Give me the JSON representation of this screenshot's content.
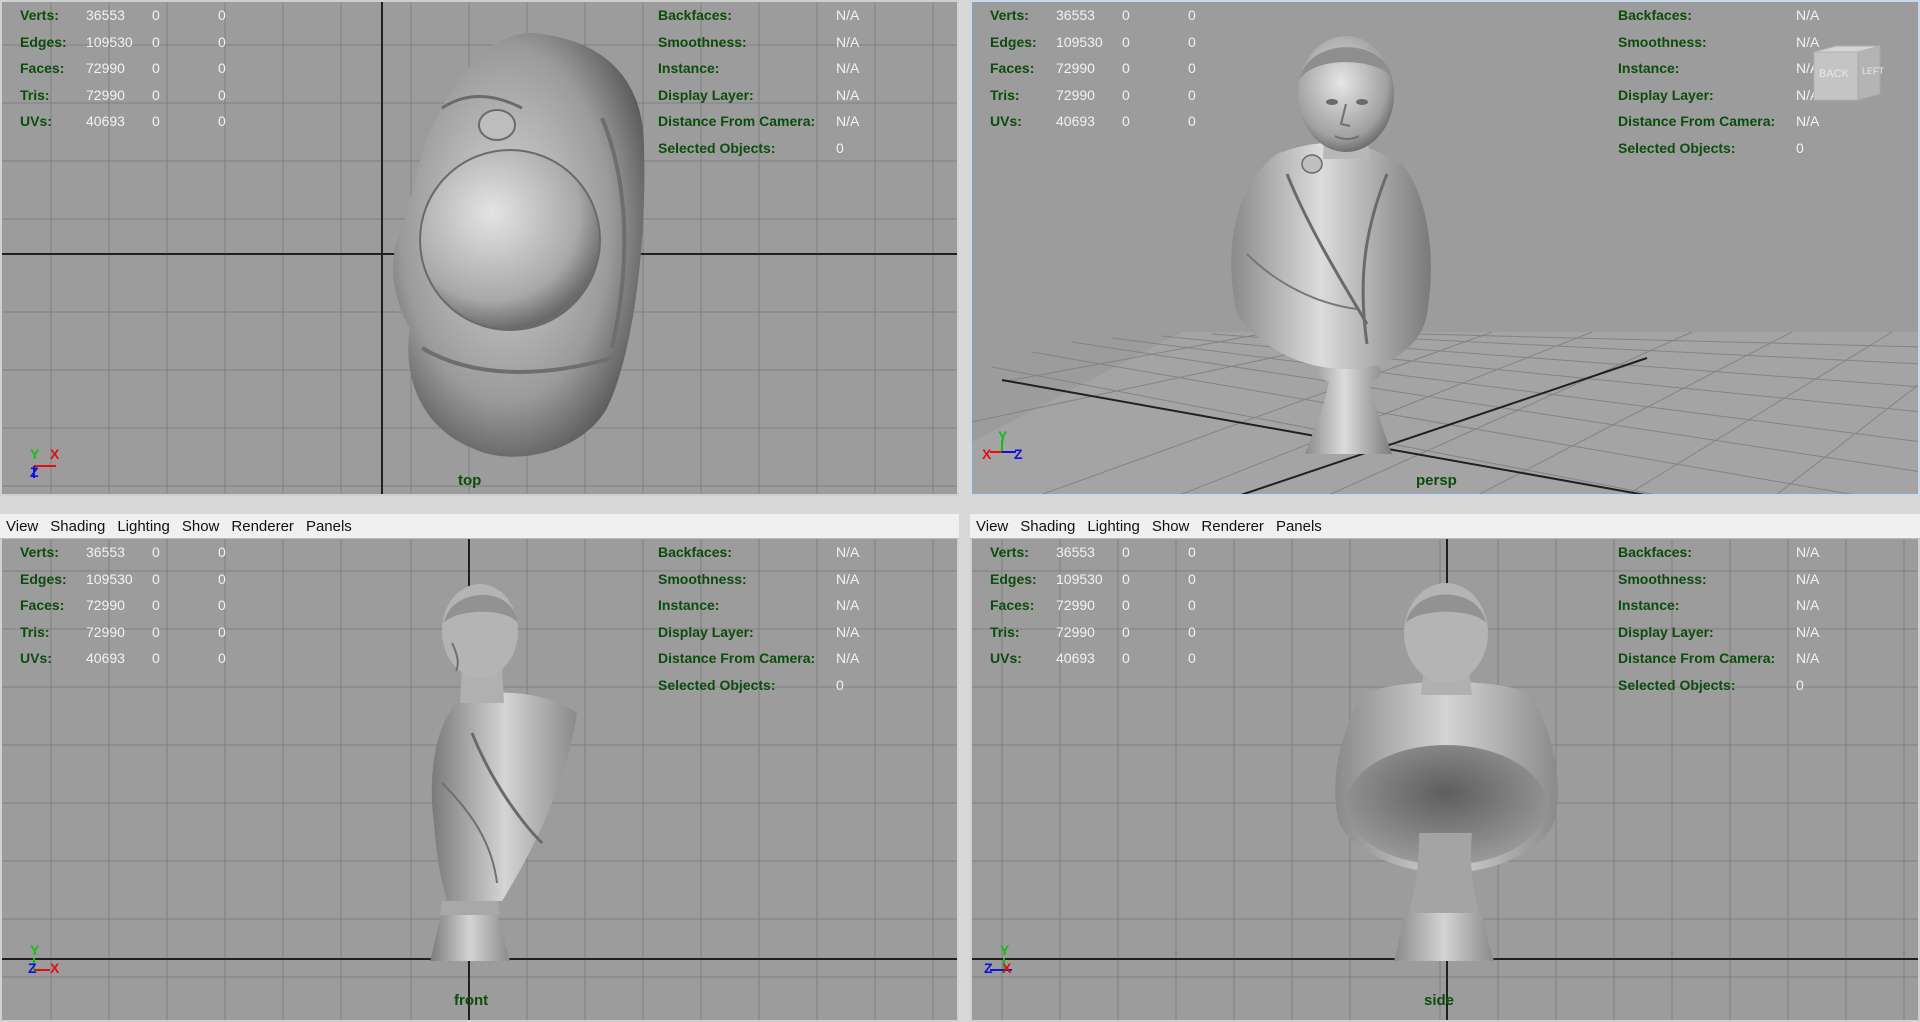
{
  "viewports": {
    "top": {
      "camera": "top",
      "hud_left": [
        {
          "label": "Verts:",
          "v1": "36553",
          "v2": "0",
          "v3": "0"
        },
        {
          "label": "Edges:",
          "v1": "109530",
          "v2": "0",
          "v3": "0"
        },
        {
          "label": "Faces:",
          "v1": "72990",
          "v2": "0",
          "v3": "0"
        },
        {
          "label": "Tris:",
          "v1": "72990",
          "v2": "0",
          "v3": "0"
        },
        {
          "label": "UVs:",
          "v1": "40693",
          "v2": "0",
          "v3": "0"
        }
      ],
      "hud_right": [
        {
          "label": "Backfaces:",
          "value": "N/A"
        },
        {
          "label": "Smoothness:",
          "value": "N/A"
        },
        {
          "label": "Instance:",
          "value": "N/A"
        },
        {
          "label": "Display Layer:",
          "value": "N/A"
        },
        {
          "label": "Distance From Camera:",
          "value": "N/A"
        },
        {
          "label": "Selected Objects:",
          "value": "0"
        }
      ],
      "axes": [
        "Y",
        "X",
        "Z"
      ]
    },
    "persp": {
      "camera": "persp",
      "hud_left": [
        {
          "label": "Verts:",
          "v1": "36553",
          "v2": "0",
          "v3": "0"
        },
        {
          "label": "Edges:",
          "v1": "109530",
          "v2": "0",
          "v3": "0"
        },
        {
          "label": "Faces:",
          "v1": "72990",
          "v2": "0",
          "v3": "0"
        },
        {
          "label": "Tris:",
          "v1": "72990",
          "v2": "0",
          "v3": "0"
        },
        {
          "label": "UVs:",
          "v1": "40693",
          "v2": "0",
          "v3": "0"
        }
      ],
      "hud_right": [
        {
          "label": "Backfaces:",
          "value": "N/A"
        },
        {
          "label": "Smoothness:",
          "value": "N/A"
        },
        {
          "label": "Instance:",
          "value": "N/A"
        },
        {
          "label": "Display Layer:",
          "value": "N/A"
        },
        {
          "label": "Distance From Camera:",
          "value": "N/A"
        },
        {
          "label": "Selected Objects:",
          "value": "0"
        }
      ],
      "axes": [
        "X",
        "Y",
        "Z"
      ],
      "viewcube": {
        "back": "BACK",
        "left": "LEFT"
      }
    },
    "front": {
      "camera": "front",
      "menu": [
        "View",
        "Shading",
        "Lighting",
        "Show",
        "Renderer",
        "Panels"
      ],
      "hud_left": [
        {
          "label": "Verts:",
          "v1": "36553",
          "v2": "0",
          "v3": "0"
        },
        {
          "label": "Edges:",
          "v1": "109530",
          "v2": "0",
          "v3": "0"
        },
        {
          "label": "Faces:",
          "v1": "72990",
          "v2": "0",
          "v3": "0"
        },
        {
          "label": "Tris:",
          "v1": "72990",
          "v2": "0",
          "v3": "0"
        },
        {
          "label": "UVs:",
          "v1": "40693",
          "v2": "0",
          "v3": "0"
        }
      ],
      "hud_right": [
        {
          "label": "Backfaces:",
          "value": "N/A"
        },
        {
          "label": "Smoothness:",
          "value": "N/A"
        },
        {
          "label": "Instance:",
          "value": "N/A"
        },
        {
          "label": "Display Layer:",
          "value": "N/A"
        },
        {
          "label": "Distance From Camera:",
          "value": "N/A"
        },
        {
          "label": "Selected Objects:",
          "value": "0"
        }
      ],
      "axes": [
        "Y",
        "Z",
        "X"
      ]
    },
    "side": {
      "camera": "side",
      "menu": [
        "View",
        "Shading",
        "Lighting",
        "Show",
        "Renderer",
        "Panels"
      ],
      "hud_left": [
        {
          "label": "Verts:",
          "v1": "36553",
          "v2": "0",
          "v3": "0"
        },
        {
          "label": "Edges:",
          "v1": "109530",
          "v2": "0",
          "v3": "0"
        },
        {
          "label": "Faces:",
          "v1": "72990",
          "v2": "0",
          "v3": "0"
        },
        {
          "label": "Tris:",
          "v1": "72990",
          "v2": "0",
          "v3": "0"
        },
        {
          "label": "UVs:",
          "v1": "40693",
          "v2": "0",
          "v3": "0"
        }
      ],
      "hud_right": [
        {
          "label": "Backfaces:",
          "value": "N/A"
        },
        {
          "label": "Smoothness:",
          "value": "N/A"
        },
        {
          "label": "Instance:",
          "value": "N/A"
        },
        {
          "label": "Display Layer:",
          "value": "N/A"
        },
        {
          "label": "Distance From Camera:",
          "value": "N/A"
        },
        {
          "label": "Selected Objects:",
          "value": "0"
        }
      ],
      "axes": [
        "Y",
        "Z",
        "X"
      ]
    }
  },
  "colors": {
    "viewport_bg": "#9c9c9c",
    "grid_line": "#7e7e7e",
    "axis_line": "#202020",
    "hud_label": "#0c4c0c",
    "hud_value": "#f2f2f2",
    "axis_x": "#e01010",
    "axis_y": "#10c010",
    "axis_z": "#1010e0",
    "active_border": "#c8d8f0"
  }
}
